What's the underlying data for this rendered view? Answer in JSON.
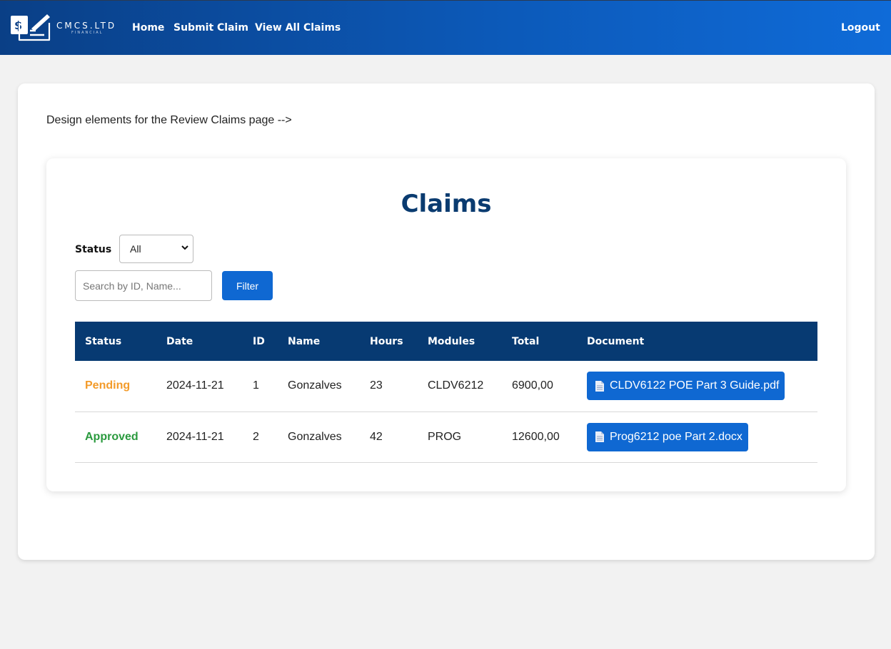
{
  "colors": {
    "nav_gradient_start": "#0a3f86",
    "nav_gradient_end": "#0f6bd8",
    "title_color": "#0a3b70",
    "table_header_bg": "#073a72",
    "button_blue": "#0f68d2",
    "pending": "#f39b2a",
    "approved": "#2a9a3e"
  },
  "brand": {
    "name": "CMCS.LTD",
    "tagline": "FINANCIAL",
    "icon": "document-dollar-pen-icon"
  },
  "nav": {
    "home": "Home",
    "submit_claim": "Submit Claim",
    "view_all_claims": "View All Claims",
    "logout": "Logout"
  },
  "page": {
    "note": "Design elements for the Review Claims page -->",
    "title": "Claims"
  },
  "filter": {
    "status_label": "Status",
    "status_selected": "All",
    "search_placeholder": "Search by ID, Name...",
    "filter_button": "Filter"
  },
  "table": {
    "headers": [
      "Status",
      "Date",
      "ID",
      "Name",
      "Hours",
      "Modules",
      "Total",
      "Document"
    ],
    "rows": [
      {
        "status": "Pending",
        "date": "2024-11-21",
        "id": "1",
        "name": "Gonzalves",
        "hours": "23",
        "modules": "CLDV6212",
        "total": "6900,00",
        "document": "CLDV6122 POE Part 3 Guide.pdf"
      },
      {
        "status": "Approved",
        "date": "2024-11-21",
        "id": "2",
        "name": "Gonzalves",
        "hours": "42",
        "modules": "PROG",
        "total": "12600,00",
        "document": "Prog6212 poe Part 2.docx"
      }
    ]
  }
}
